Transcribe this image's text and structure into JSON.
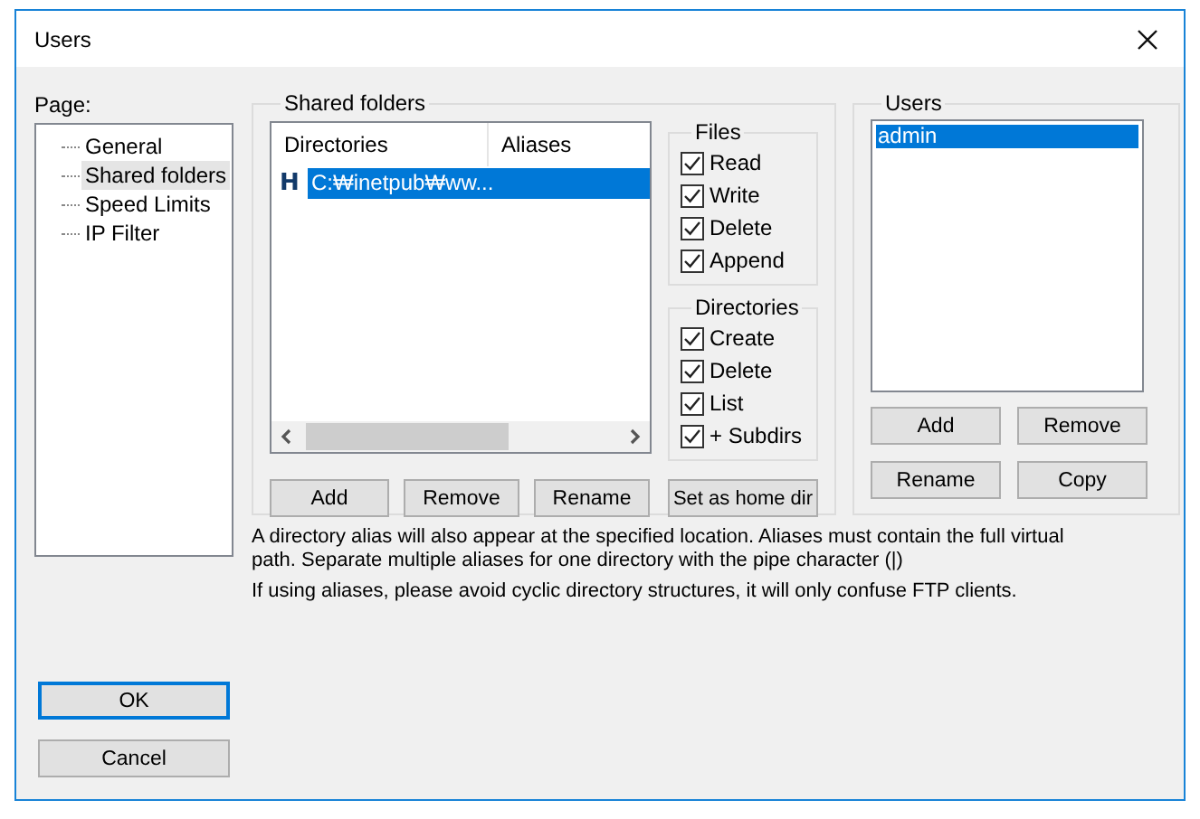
{
  "window": {
    "title": "Users"
  },
  "page": {
    "label": "Page:",
    "items": [
      {
        "label": "General",
        "selected": false
      },
      {
        "label": "Shared folders",
        "selected": true
      },
      {
        "label": "Speed Limits",
        "selected": false
      },
      {
        "label": "IP Filter",
        "selected": false
      }
    ]
  },
  "shared_folders": {
    "title": "Shared folders",
    "columns": [
      "Directories",
      "Aliases"
    ],
    "rows": [
      {
        "marker": "H",
        "directory": "C:₩inetpub₩ww...",
        "selected": true
      }
    ],
    "buttons": [
      "Add",
      "Remove",
      "Rename",
      "Set as home dir"
    ]
  },
  "files": {
    "title": "Files",
    "items": [
      {
        "label": "Read",
        "checked": true
      },
      {
        "label": "Write",
        "checked": true
      },
      {
        "label": "Delete",
        "checked": true
      },
      {
        "label": "Append",
        "checked": true
      }
    ]
  },
  "directories": {
    "title": "Directories",
    "items": [
      {
        "label": "Create",
        "checked": true
      },
      {
        "label": "Delete",
        "checked": true
      },
      {
        "label": "List",
        "checked": true
      },
      {
        "label": "+ Subdirs",
        "checked": true
      }
    ]
  },
  "users": {
    "title": "Users",
    "items": [
      {
        "name": "admin",
        "selected": true
      }
    ],
    "buttons": [
      "Add",
      "Remove",
      "Rename",
      "Copy"
    ]
  },
  "notes": [
    "A directory alias will also appear at the specified location. Aliases must contain the full virtual path. Separate multiple aliases for one directory with the pipe character (|)",
    "If using aliases, please avoid cyclic directory structures, it will only confuse FTP clients."
  ],
  "buttons": [
    {
      "label": "OK",
      "default": true
    },
    {
      "label": "Cancel",
      "default": false
    }
  ]
}
